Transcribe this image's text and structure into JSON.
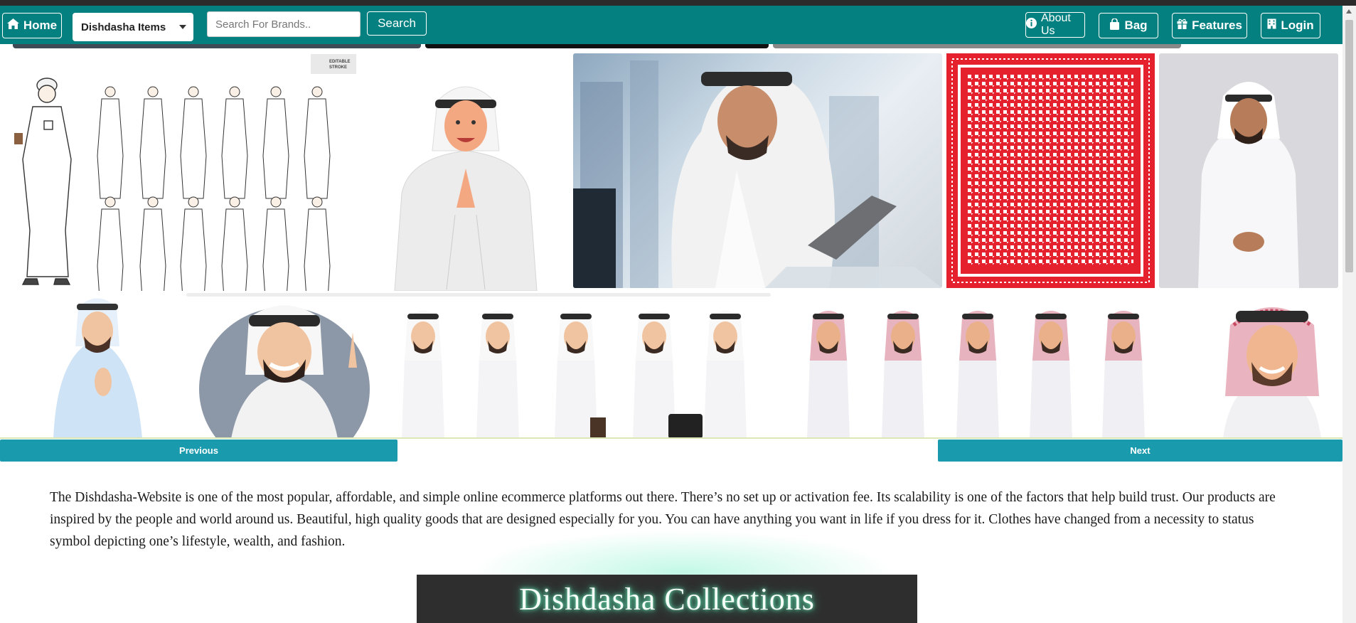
{
  "navbar": {
    "home_label": "Home",
    "dropdown_label": "Dishdasha Items",
    "search_placeholder": "Search For Brands..",
    "search_button": "Search",
    "about_label": "About Us",
    "bag_label": "Bag",
    "features_label": "Features",
    "login_label": "Login",
    "icons": {
      "home": "home-icon",
      "about": "info-icon",
      "bag": "shopping-bag-icon",
      "features": "gift-icon",
      "login": "building-icon"
    }
  },
  "gallery": {
    "editable_badge_line1": "EDITABLE",
    "editable_badge_line2": "STROKE",
    "images": [
      "figure-lineart-poses",
      "cartoon-man-greeting",
      "businessman-laptop",
      "red-shemagh-pattern",
      "man-white-thobe",
      "cartoon-man-blue-waving",
      "cartoon-man-winking",
      "cartoon-men-group-poses",
      "cartoon-men-red-shemagh-group",
      "cartoon-man-red-shemagh-smiling"
    ]
  },
  "carousel": {
    "previous_label": "Previous",
    "next_label": "Next"
  },
  "intro": {
    "text": "The Dishdasha-Website is one of the most popular, affordable, and simple online ecommerce platforms out there. There’s no set up or activation fee. Its scalability is one of the factors that help build trust. Our products are inspired by the people and world around us. Beautiful, high quality goods that are designed especially for you. You can have anything you want in life if you dress for it. Clothes have changed from a necessity to status symbol depicting one’s lifestyle, wealth, and fashion."
  },
  "collections": {
    "heading": "Dishdasha Collections"
  },
  "colors": {
    "navbar": "#058080",
    "carousel_button": "#1a9aad",
    "heading_bg": "#2e2e2e",
    "shemagh_red": "#e4212c"
  }
}
